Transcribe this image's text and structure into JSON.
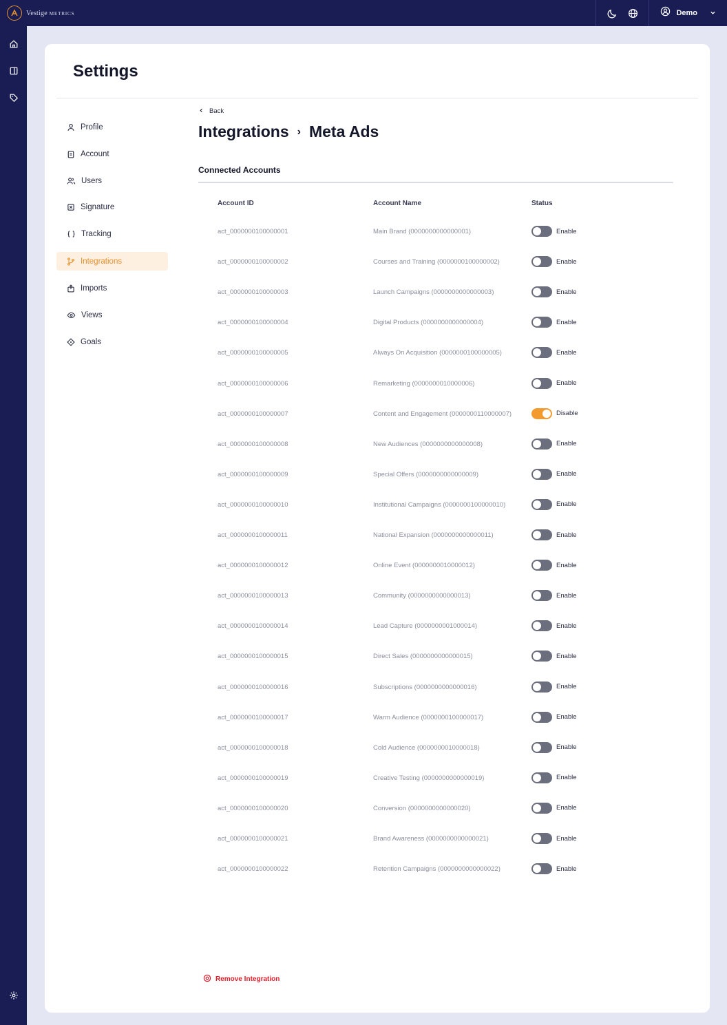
{
  "app": {
    "brand_main": "Vestige",
    "brand_sub": "Metrics",
    "user_name": "Demo"
  },
  "page": {
    "title": "Settings"
  },
  "nav": [
    {
      "label": "Profile",
      "icon": "user-icon"
    },
    {
      "label": "Account",
      "icon": "clipboard-icon"
    },
    {
      "label": "Users",
      "icon": "users-icon"
    },
    {
      "label": "Signature",
      "icon": "signature-icon"
    },
    {
      "label": "Tracking",
      "icon": "braces-icon"
    },
    {
      "label": "Integrations",
      "icon": "branch-icon",
      "active": true
    },
    {
      "label": "Imports",
      "icon": "import-icon"
    },
    {
      "label": "Views",
      "icon": "eye-icon"
    },
    {
      "label": "Goals",
      "icon": "diamond-icon"
    }
  ],
  "content": {
    "back_label": "Back",
    "breadcrumb_parent": "Integrations",
    "breadcrumb_sep": "›",
    "breadcrumb_current": "Meta Ads",
    "section_title": "Connected Accounts",
    "remove_label": "Remove Integration"
  },
  "table": {
    "headers": [
      "Account ID",
      "Account Name",
      "Status"
    ],
    "rows": [
      {
        "id": "act_0000000100000001",
        "name": "Main Brand (0000000000000001)",
        "status": "Enable",
        "on": false
      },
      {
        "id": "act_0000000100000002",
        "name": "Courses and Training (0000000100000002)",
        "status": "Enable",
        "on": false
      },
      {
        "id": "act_0000000100000003",
        "name": "Launch Campaigns (0000000000000003)",
        "status": "Enable",
        "on": false
      },
      {
        "id": "act_0000000100000004",
        "name": "Digital Products (0000000000000004)",
        "status": "Enable",
        "on": false
      },
      {
        "id": "act_0000000100000005",
        "name": "Always On Acquisition (0000000100000005)",
        "status": "Enable",
        "on": false
      },
      {
        "id": "act_0000000100000006",
        "name": "Remarketing (0000000010000006)",
        "status": "Enable",
        "on": false
      },
      {
        "id": "act_0000000100000007",
        "name": "Content and Engagement (0000000110000007)",
        "status": "Disable",
        "on": true
      },
      {
        "id": "act_0000000100000008",
        "name": "New Audiences (0000000000000008)",
        "status": "Enable",
        "on": false
      },
      {
        "id": "act_0000000100000009",
        "name": "Special Offers (0000000000000009)",
        "status": "Enable",
        "on": false
      },
      {
        "id": "act_0000000100000010",
        "name": "Institutional Campaigns (0000000100000010)",
        "status": "Enable",
        "on": false
      },
      {
        "id": "act_0000000100000011",
        "name": "National Expansion (0000000000000011)",
        "status": "Enable",
        "on": false
      },
      {
        "id": "act_0000000100000012",
        "name": "Online Event (0000000010000012)",
        "status": "Enable",
        "on": false
      },
      {
        "id": "act_0000000100000013",
        "name": "Community (0000000000000013)",
        "status": "Enable",
        "on": false
      },
      {
        "id": "act_0000000100000014",
        "name": "Lead Capture (0000000001000014)",
        "status": "Enable",
        "on": false
      },
      {
        "id": "act_0000000100000015",
        "name": "Direct Sales (0000000000000015)",
        "status": "Enable",
        "on": false
      },
      {
        "id": "act_0000000100000016",
        "name": "Subscriptions (0000000000000016)",
        "status": "Enable",
        "on": false
      },
      {
        "id": "act_0000000100000017",
        "name": "Warm Audience (0000000100000017)",
        "status": "Enable",
        "on": false
      },
      {
        "id": "act_0000000100000018",
        "name": "Cold Audience (0000000010000018)",
        "status": "Enable",
        "on": false
      },
      {
        "id": "act_0000000100000019",
        "name": "Creative Testing (0000000000000019)",
        "status": "Enable",
        "on": false
      },
      {
        "id": "act_0000000100000020",
        "name": "Conversion (0000000000000020)",
        "status": "Enable",
        "on": false
      },
      {
        "id": "act_0000000100000021",
        "name": "Brand Awareness (0000000000000021)",
        "status": "Enable",
        "on": false
      },
      {
        "id": "act_0000000100000022",
        "name": "Retention Campaigns (0000000000000022)",
        "status": "Enable",
        "on": false
      }
    ]
  },
  "colors": {
    "sidebar": "#1a1d54",
    "accent": "#f29a2e",
    "danger": "#e11d2a"
  }
}
